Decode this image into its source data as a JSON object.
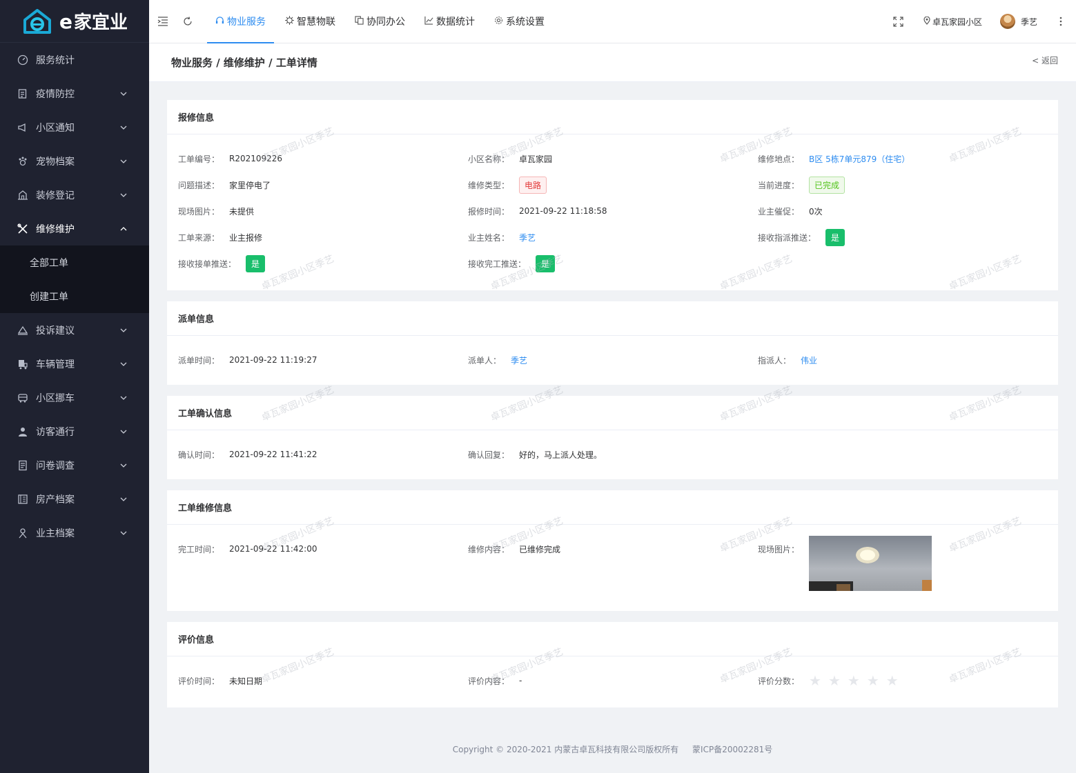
{
  "app": {
    "logo_text": "家宜业",
    "logo_e": "e"
  },
  "sidebar": {
    "items": [
      {
        "label": "服务统计",
        "icon": "dashboard-icon"
      },
      {
        "label": "疫情防控",
        "icon": "clipboard-icon"
      },
      {
        "label": "小区通知",
        "icon": "megaphone-icon"
      },
      {
        "label": "宠物档案",
        "icon": "pet-icon"
      },
      {
        "label": "装修登记",
        "icon": "building-icon"
      },
      {
        "label": "维修维护",
        "icon": "tools-icon"
      },
      {
        "label": "投诉建议",
        "icon": "complaint-icon"
      },
      {
        "label": "车辆管理",
        "icon": "car-icon"
      },
      {
        "label": "小区挪车",
        "icon": "bus-icon"
      },
      {
        "label": "访客通行",
        "icon": "visitor-icon"
      },
      {
        "label": "问卷调查",
        "icon": "survey-icon"
      },
      {
        "label": "房产档案",
        "icon": "house-icon"
      },
      {
        "label": "业主档案",
        "icon": "owner-icon"
      }
    ],
    "submenu": [
      "全部工单",
      "创建工单"
    ]
  },
  "topbar": {
    "tabs": [
      {
        "label": "物业服务",
        "icon": "headset-icon"
      },
      {
        "label": "智慧物联",
        "icon": "chip-icon"
      },
      {
        "label": "协同办公",
        "icon": "copy-icon"
      },
      {
        "label": "数据统计",
        "icon": "chart-icon"
      },
      {
        "label": "系统设置",
        "icon": "gear-icon"
      }
    ],
    "community": "卓瓦家园小区",
    "user": "季艺"
  },
  "header": {
    "breadcrumb": "物业服务 / 维修维护 / 工单详情",
    "back": "< 返回"
  },
  "report": {
    "title": "报修信息",
    "order_no_k": "工单编号：",
    "order_no": "R202109226",
    "community_k": "小区名称：",
    "community": "卓瓦家园",
    "location_k": "维修地点：",
    "location": "B区 5栋7单元879（住宅）",
    "desc_k": "问题描述：",
    "desc": "家里停电了",
    "type_k": "维修类型：",
    "type": "电路",
    "progress_k": "当前进度：",
    "progress": "已完成",
    "photo_k": "现场图片：",
    "photo": "未提供",
    "time_k": "报修时间：",
    "time": "2021-09-22 11:18:58",
    "urge_k": "业主催促：",
    "urge": "0次",
    "source_k": "工单来源：",
    "source": "业主报修",
    "owner_k": "业主姓名：",
    "owner": "季艺",
    "assign_push_k": "接收指派推送：",
    "assign_push": "是",
    "accept_push_k": "接收接单推送：",
    "accept_push": "是",
    "finish_push_k": "接收完工推送：",
    "finish_push": "是"
  },
  "dispatch": {
    "title": "派单信息",
    "time_k": "派单时间：",
    "time": "2021-09-22 11:19:27",
    "by_k": "派单人：",
    "by": "季艺",
    "to_k": "指派人：",
    "to": "伟业"
  },
  "confirm": {
    "title": "工单确认信息",
    "time_k": "确认时间：",
    "time": "2021-09-22 11:41:22",
    "reply_k": "确认回复：",
    "reply": "好的，马上派人处理。"
  },
  "repair": {
    "title": "工单维修信息",
    "time_k": "完工时间：",
    "time": "2021-09-22 11:42:00",
    "content_k": "维修内容：",
    "content": "已维修完成",
    "photo_k": "现场图片："
  },
  "review": {
    "title": "评价信息",
    "time_k": "评价时间：",
    "time": "未知日期",
    "content_k": "评价内容：",
    "content": "-",
    "score_k": "评价分数：",
    "score": 0,
    "max_score": 5
  },
  "watermark": "卓瓦家园小区季艺",
  "footer": {
    "copyright": "Copyright © 2020-2021 内蒙古卓瓦科技有限公司版权所有",
    "icp": "蒙ICP备20002281号"
  },
  "colors": {
    "accent": "#2d8cf0",
    "sidebar_bg": "#1f2230",
    "success": "#19be6b",
    "danger": "#e23b3b"
  }
}
